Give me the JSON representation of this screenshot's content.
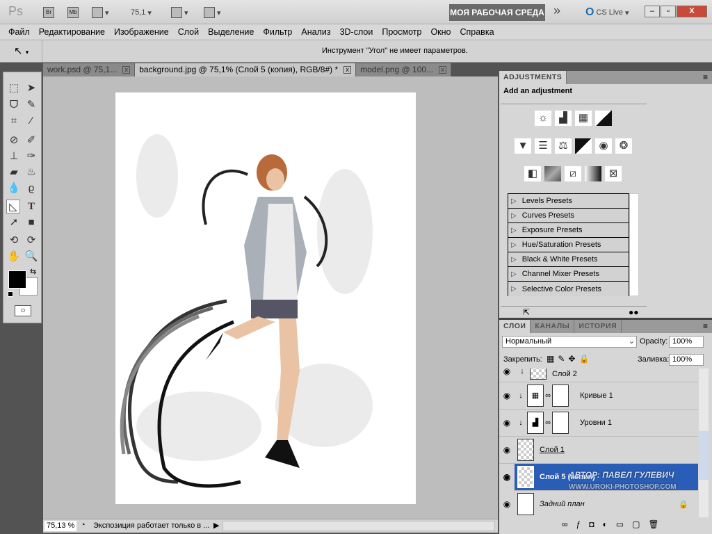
{
  "appbar": {
    "logo": "Ps",
    "bridge": "Br",
    "mini_bridge": "Mb",
    "zoom": "75,1",
    "workspace": "МОЯ РАБОЧАЯ СРЕДА",
    "more": "»",
    "cs_live": "CS Live",
    "minimize": "–",
    "restore": "▫",
    "close": "X"
  },
  "menu": [
    "Файл",
    "Редактирование",
    "Изображение",
    "Слой",
    "Выделение",
    "Фильтр",
    "Анализ",
    "3D-слои",
    "Просмотр",
    "Окно",
    "Справка"
  ],
  "options": {
    "message": "Инструмент \"Угол\" не имеет параметров."
  },
  "tabs": [
    {
      "label": "work.psd @ 75,1...",
      "active": false
    },
    {
      "label": "background.jpg @ 75,1% (Слой 5 (копия), RGB/8#) *",
      "active": true
    },
    {
      "label": "model.png @ 100...",
      "active": false
    }
  ],
  "status": {
    "zoom": "75,13 %",
    "info": "Экспозиция работает только в ..."
  },
  "adjustments": {
    "tab": "ADJUSTMENTS",
    "heading": "Add an adjustment",
    "presets": [
      "Levels Presets",
      "Curves Presets",
      "Exposure Presets",
      "Hue/Saturation Presets",
      "Black & White Presets",
      "Channel Mixer Presets",
      "Selective Color Presets"
    ]
  },
  "layers": {
    "tabs": [
      "СЛОИ",
      "КАНАЛЫ",
      "ИСТОРИЯ"
    ],
    "blend_mode": "Нормальный",
    "opacity_label": "Opacity:",
    "opacity": "100%",
    "lock_label": "Закрепить:",
    "fill_label": "Заливка:",
    "fill": "100%",
    "items": [
      {
        "name": "Слой 2",
        "type": "pixel",
        "clipped": true
      },
      {
        "name": "Кривые 1",
        "type": "curves",
        "clipped": true
      },
      {
        "name": "Уровни 1",
        "type": "levels",
        "clipped": true
      },
      {
        "name": "Слой 1",
        "type": "pixel"
      },
      {
        "name": "Слой 5 (копия)",
        "type": "pixel",
        "selected": true
      },
      {
        "name": "Задний план",
        "type": "background",
        "locked": true
      }
    ]
  },
  "watermark": {
    "author": "АВТОР: ПАВЕЛ ГУЛЕВИЧ",
    "site": "WWW.UROKI-PHOTOSHOP.COM"
  },
  "colors": {
    "selection": "#2a5db5",
    "foreground": "#000000",
    "background": "#ffffff"
  }
}
